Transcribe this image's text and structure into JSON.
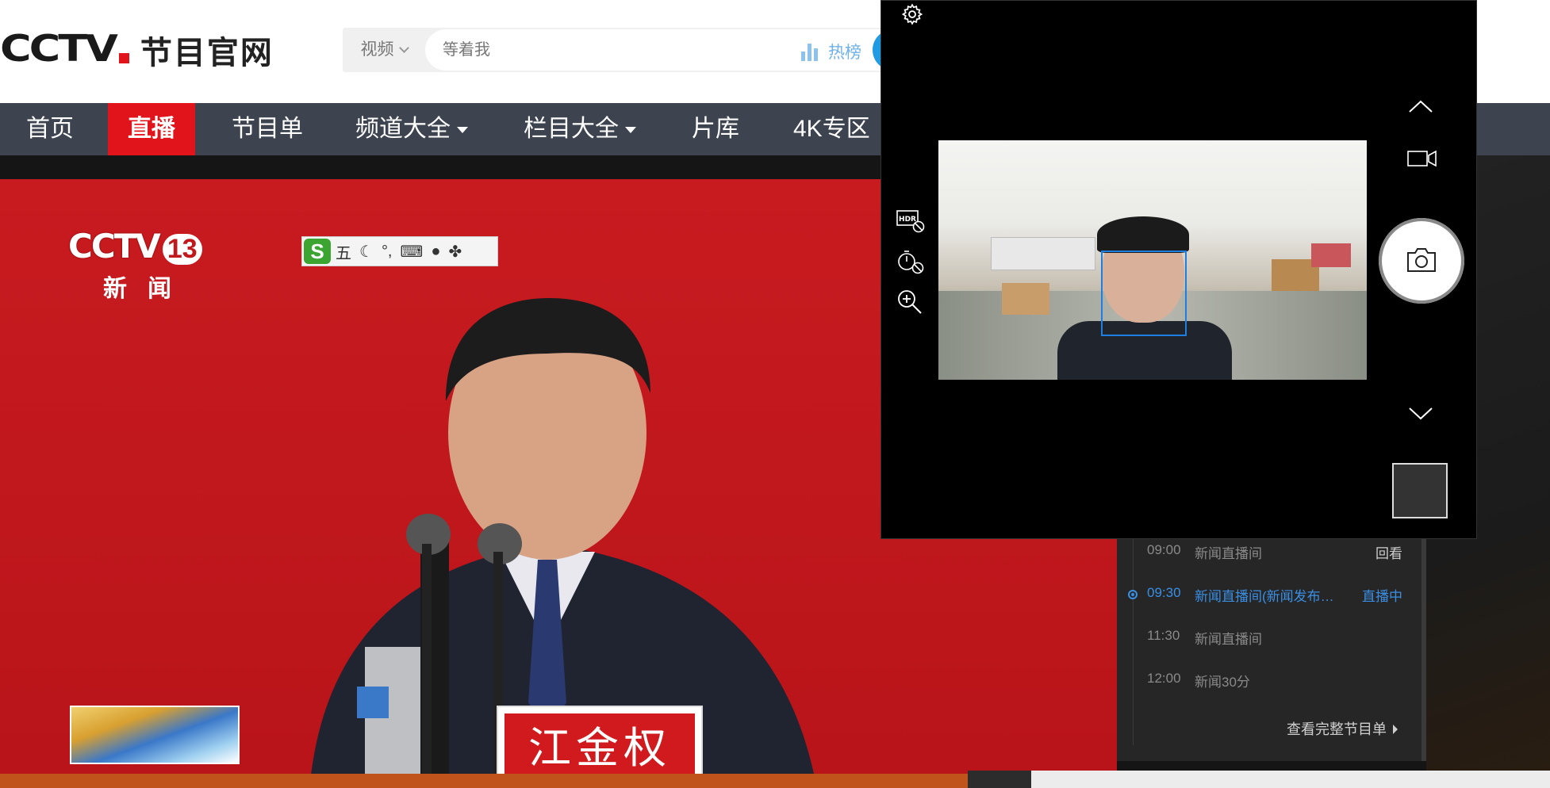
{
  "header": {
    "logo_text": "CCTV",
    "logo_subtitle": "节目官网",
    "search": {
      "category": "视频",
      "placeholder": "等着我",
      "hot_label": "热榜"
    }
  },
  "nav": {
    "items": [
      {
        "label": "首页"
      },
      {
        "label": "直播",
        "active": true
      },
      {
        "label": "节目单"
      },
      {
        "label": "频道大全",
        "dropdown": true
      },
      {
        "label": "栏目大全",
        "dropdown": true
      },
      {
        "label": "片库"
      },
      {
        "label": "4K专区"
      }
    ]
  },
  "player": {
    "channel_logo": "CCTV",
    "channel_number": "13",
    "channel_name": "新闻",
    "ime_toolbar": {
      "logo": "S",
      "mode": "五",
      "punct": "°,"
    },
    "nameplate": "江金权"
  },
  "schedule": {
    "rows": [
      {
        "time": "09:00",
        "title": "新闻直播间",
        "status": "回看",
        "live": false
      },
      {
        "time": "09:30",
        "title": "新闻直播间(新闻发布…",
        "status": "直播中",
        "live": true
      },
      {
        "time": "11:30",
        "title": "新闻直播间",
        "status": "",
        "live": false
      },
      {
        "time": "12:00",
        "title": "新闻30分",
        "status": "",
        "live": false
      }
    ],
    "more_label": "查看完整节目单"
  },
  "camera": {
    "icons": [
      "settings-icon",
      "hdr-off-icon",
      "timer-off-icon",
      "zoom-icon",
      "chevron-up-icon",
      "video-mode-icon",
      "photo-shutter-icon",
      "chevron-down-icon"
    ],
    "hdr_label": "HDR"
  },
  "colors": {
    "brand_red": "#e1141c",
    "nav_bg": "#3d4450",
    "live_blue": "#3a8fe4",
    "face_box": "#1e7fe0"
  }
}
